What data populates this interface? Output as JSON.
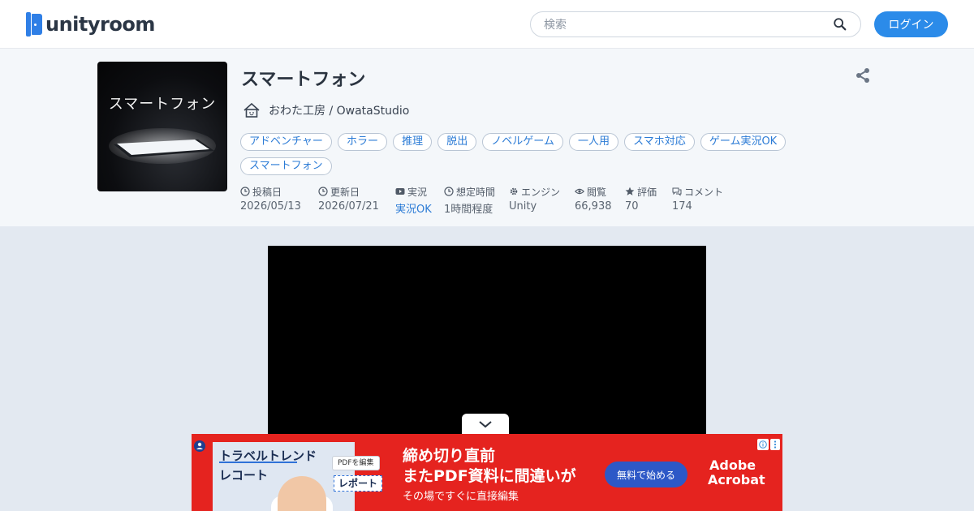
{
  "header": {
    "logo_text": "unityroom",
    "search_placeholder": "検索",
    "login_label": "ログイン"
  },
  "game": {
    "title": "スマートフォン",
    "thumbnail_text": "スマートフォン",
    "developer": "おわた工房 / OwataStudio",
    "tags": [
      "アドベンチャー",
      "ホラー",
      "推理",
      "脱出",
      "ノベルゲーム",
      "一人用",
      "スマホ対応",
      "ゲーム実況OK",
      "スマートフォン"
    ],
    "meta": {
      "posted": {
        "label": "投稿日",
        "value": "2026/05/13",
        "icon": "clock-icon"
      },
      "updated": {
        "label": "更新日",
        "value": "2026/07/21",
        "icon": "clock-icon"
      },
      "streaming": {
        "label": "実況",
        "value": "実況OK",
        "icon": "video-icon"
      },
      "playtime": {
        "label": "想定時間",
        "value": "1時間程度",
        "icon": "clock-icon"
      },
      "engine": {
        "label": "エンジン",
        "value": "Unity",
        "icon": "gear-icon"
      },
      "views": {
        "label": "閲覧",
        "value": "66,938",
        "icon": "eye-icon"
      },
      "rating": {
        "label": "評価",
        "value": "70",
        "icon": "star-icon"
      },
      "comments": {
        "label": "コメント",
        "value": "174",
        "icon": "comment-icon"
      }
    }
  },
  "ad": {
    "left_title_1": "トラベルトレンド",
    "left_title_2": "レコート",
    "pdf_chip": "PDFを編集",
    "report_label": "レポート",
    "headline_1": "締め切り直前",
    "headline_2": "またPDF資料に間違いが",
    "subline": "その場ですぐに直接編集",
    "cta_label": "無料で始める",
    "brand_1": "Adobe",
    "brand_2": "Acrobat"
  },
  "colors": {
    "accent": "#2b8be9",
    "link": "#2b7bd6",
    "ad_red": "#e5231f"
  }
}
